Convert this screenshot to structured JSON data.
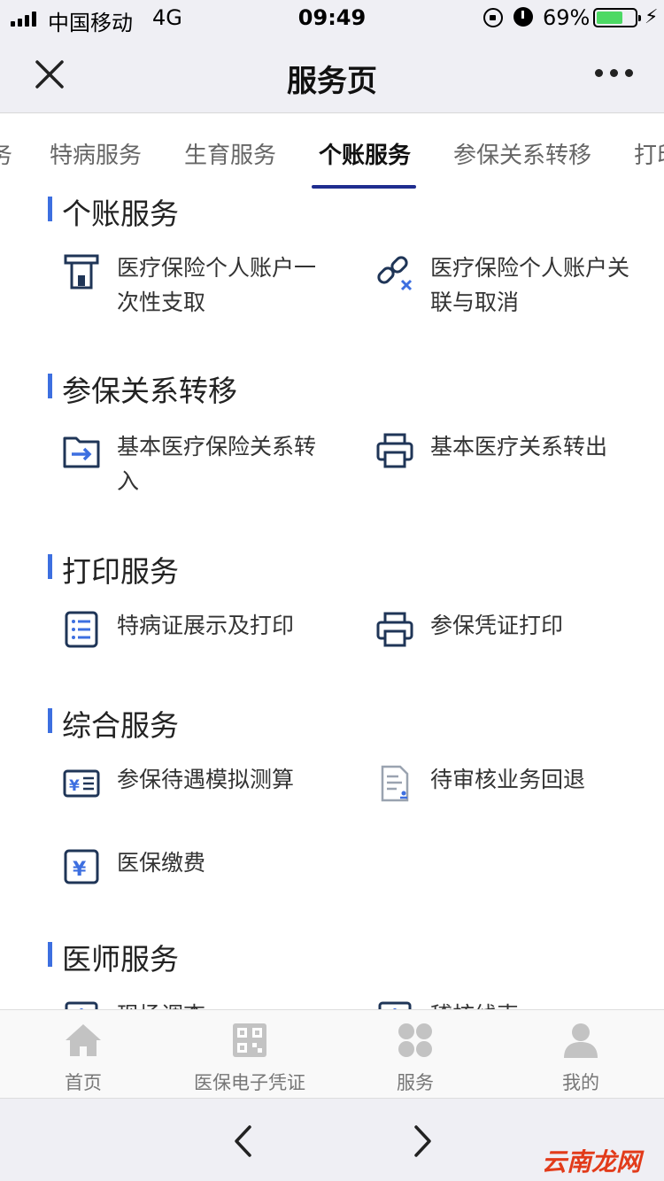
{
  "status_bar": {
    "carrier": "中国移动",
    "network": "4G",
    "time": "09:49",
    "battery_percent": "69%",
    "battery_level": 0.69,
    "charge_symbol": "⚡"
  },
  "nav": {
    "title": "服务页"
  },
  "tabs": [
    {
      "label": "务",
      "active": false
    },
    {
      "label": "特病服务",
      "active": false
    },
    {
      "label": "生育服务",
      "active": false
    },
    {
      "label": "个账服务",
      "active": true
    },
    {
      "label": "参保关系转移",
      "active": false
    },
    {
      "label": "打印",
      "active": false
    }
  ],
  "sections": [
    {
      "title": "个账服务",
      "items": [
        {
          "label": "医疗保险个人账户一次性支取",
          "icon": "atm-icon"
        },
        {
          "label": "医疗保险个人账户关联与取消",
          "icon": "unlink-icon"
        }
      ]
    },
    {
      "title": "参保关系转移",
      "items": [
        {
          "label": "基本医疗保险关系转入",
          "icon": "folder-transfer-icon"
        },
        {
          "label": "基本医疗关系转出",
          "icon": "printer-icon"
        }
      ]
    },
    {
      "title": "打印服务",
      "items": [
        {
          "label": "特病证展示及打印",
          "icon": "list-icon"
        },
        {
          "label": "参保凭证打印",
          "icon": "printer-icon"
        }
      ]
    },
    {
      "title": "综合服务",
      "items": [
        {
          "label": "参保待遇模拟测算",
          "icon": "yuan-card-icon"
        },
        {
          "label": "待审核业务回退",
          "icon": "document-icon"
        },
        {
          "label": "医保缴费",
          "icon": "yuan-icon"
        }
      ]
    },
    {
      "title": "医师服务",
      "items": [
        {
          "label": "现场调查",
          "icon": "medical-icon"
        },
        {
          "label": "稽核线索",
          "icon": "medical-icon"
        }
      ]
    }
  ],
  "tabbar": [
    {
      "label": "首页",
      "icon": "home-icon"
    },
    {
      "label": "医保电子凭证",
      "icon": "qr-code-icon"
    },
    {
      "label": "服务",
      "icon": "grid-icon"
    },
    {
      "label": "我的",
      "icon": "user-icon"
    }
  ],
  "watermark": "云南龙网",
  "colors": {
    "accent": "#3d6fe0",
    "tab_underline": "#1f2d8f",
    "icon": "#1f3557"
  }
}
